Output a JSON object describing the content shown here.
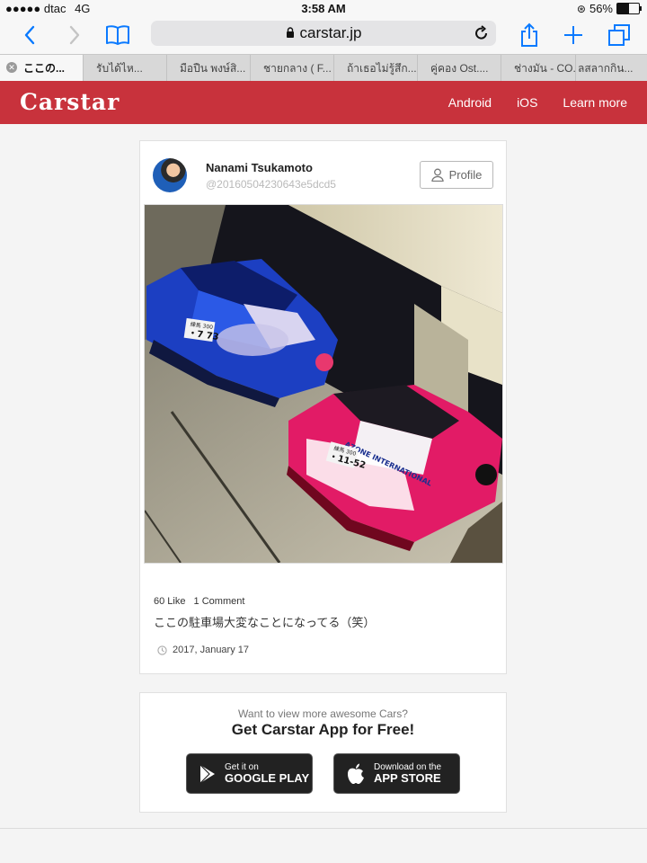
{
  "status_bar": {
    "carrier": "●●●●● dtac",
    "network": "4G",
    "time": "3:58 AM",
    "battery": "56%",
    "battery_level": 0.56
  },
  "browser": {
    "url": "carstar.jp",
    "tabs": [
      {
        "label": "ここの..."
      },
      {
        "label": "รับได้ไห..."
      },
      {
        "label": "มือปืน พงษ์สิ..."
      },
      {
        "label": "ชายกลาง ( F..."
      },
      {
        "label": "ถ้าเธอไม่รู้สึก..."
      },
      {
        "label": "คู่คอง Ost...."
      },
      {
        "label": "ช่างมัน - CO..."
      },
      {
        "label": "ลสลากกิน..."
      }
    ]
  },
  "site": {
    "logo": "Carstar",
    "nav": [
      "Android",
      "iOS",
      "Learn more"
    ],
    "brand_color": "#c8323c"
  },
  "post": {
    "user_name": "Nanami Tsukamoto",
    "user_handle": "@20160504230643e5dcd5",
    "profile_label": "Profile",
    "likes": "60 Like",
    "comments": "1 Comment",
    "caption": "ここの駐車場大変なことになってる（笑）",
    "date": "2017, January 17",
    "photo": {
      "plate_blue_small": "練馬 300",
      "plate_blue": "・7 73",
      "plate_pink_small": "練馬 300",
      "plate_pink": "・11-52",
      "livery_text": "AZONE INTERNATIONAL"
    }
  },
  "promo": {
    "subtitle": "Want to view more awesome Cars?",
    "title": "Get Carstar App for Free!",
    "google_small": "Get it on",
    "google_big": "GOOGLE PLAY",
    "apple_small": "Download on the",
    "apple_big": "APP STORE"
  }
}
